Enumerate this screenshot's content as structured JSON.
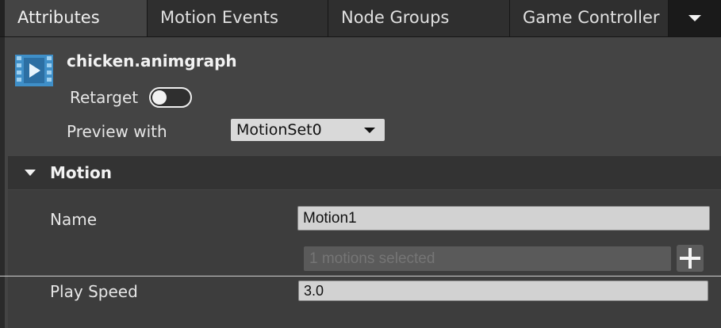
{
  "tabs": [
    {
      "label": "Attributes",
      "active": true
    },
    {
      "label": "Motion Events"
    },
    {
      "label": "Node Groups"
    },
    {
      "label": "Game Controller"
    }
  ],
  "tabs_overflow_icon": "chevron-down-icon",
  "file": {
    "icon": "video-clip-icon",
    "name": "chicken.animgraph"
  },
  "retarget": {
    "label": "Retarget",
    "enabled": false
  },
  "preview": {
    "label": "Preview with",
    "value": "MotionSet0"
  },
  "section": {
    "title": "Motion",
    "expanded": true,
    "name_label": "Name",
    "name_value": "Motion1",
    "motions_placeholder": "1 motions selected",
    "play_speed_label": "Play Speed",
    "play_speed_value": "3.0"
  },
  "colors": {
    "tab_active": "#444444",
    "panel": "#444444",
    "section_header": "#333333",
    "icon_accent": "#4a9fd8"
  }
}
